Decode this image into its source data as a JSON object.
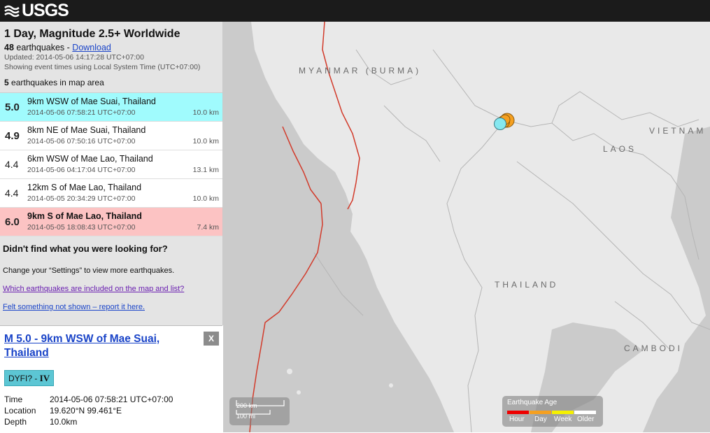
{
  "header": {
    "logo_text": "USGS"
  },
  "sidebar": {
    "title": "1 Day, Magnitude 2.5+ Worldwide",
    "count": "48",
    "count_suffix": " earthquakes - ",
    "download_label": "Download",
    "updated": "Updated: 2014-05-06 14:17:28 UTC+07:00",
    "time_note": "Showing event times using Local System Time (UTC+07:00)",
    "map_count": "5",
    "map_count_suffix": " earthquakes in map area",
    "events": [
      {
        "mag": "5.0",
        "place": "9km WSW of Mae Suai, Thailand",
        "time": "2014-05-06 07:58:21 UTC+07:00",
        "depth": "10.0 km"
      },
      {
        "mag": "4.9",
        "place": "8km NE of Mae Suai, Thailand",
        "time": "2014-05-06 07:50:16 UTC+07:00",
        "depth": "10.0 km"
      },
      {
        "mag": "4.4",
        "place": "6km WSW of Mae Lao, Thailand",
        "time": "2014-05-06 04:17:04 UTC+07:00",
        "depth": "13.1 km"
      },
      {
        "mag": "4.4",
        "place": "12km S of Mae Lao, Thailand",
        "time": "2014-05-05 20:34:29 UTC+07:00",
        "depth": "10.0 km"
      },
      {
        "mag": "6.0",
        "place": "9km S of Mae Lao, Thailand",
        "time": "2014-05-05 18:08:43 UTC+07:00",
        "depth": "7.4 km"
      }
    ],
    "help_question": "Didn't find what you were looking for?",
    "help_text": "Change your “Settings” to view more earthquakes.",
    "help_link1": "Which earthquakes are included on the map and list?",
    "help_link2": "Felt something not shown – report it here."
  },
  "detail": {
    "title": "M 5.0 - 9km WSW of Mae Suai, Thailand",
    "close_label": "X",
    "dyfi_label": "DYFI? - ",
    "dyfi_value": "IV",
    "time_label": "Time",
    "time_value": "2014-05-06 07:58:21 UTC+07:00",
    "location_label": "Location",
    "location_value": "19.620°N 99.461°E",
    "depth_label": "Depth",
    "depth_value": "10.0km"
  },
  "map": {
    "labels": {
      "myanmar": "MYANMAR (BURMA)",
      "vietnam": "VIETNAM",
      "laos": "LAOS",
      "thailand": "THAILAND",
      "cambodia": "CAMBODI"
    },
    "scale_km": "200 km",
    "scale_mi": "100 mi",
    "legend": {
      "title": "Earthquake Age",
      "items": [
        {
          "label": "Hour",
          "color": "#ee0000"
        },
        {
          "label": "Day",
          "color": "#f5a020"
        },
        {
          "label": "Week",
          "color": "#f5f000"
        },
        {
          "label": "Older",
          "color": "#ffffff"
        }
      ]
    },
    "colors": {
      "selected": "#86e8f0",
      "day": "#f5a020",
      "fault": "#d23a2a"
    }
  }
}
